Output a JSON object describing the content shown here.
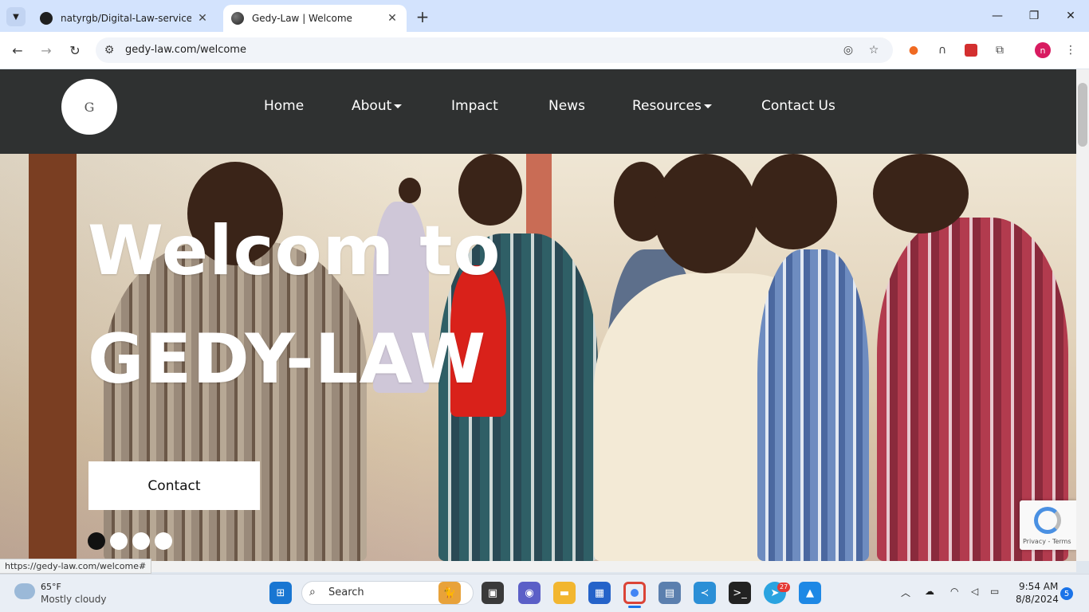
{
  "browser": {
    "tabs": [
      {
        "title": "natyrgb/Digital-Law-service: A p",
        "active": false
      },
      {
        "title": "Gedy-Law | Welcome",
        "active": true
      }
    ],
    "url": "gedy-law.com/welcome",
    "status_url": "https://gedy-law.com/welcome#"
  },
  "site": {
    "logo_letter": "G",
    "nav": {
      "home": "Home",
      "about": "About",
      "impact": "Impact",
      "news": "News",
      "resources": "Resources",
      "contact": "Contact Us"
    },
    "hero": {
      "line1": "Welcom to",
      "line2": "GEDY-LAW",
      "button": "Contact",
      "slides": 4,
      "active_slide": 1
    },
    "recaptcha": {
      "text": "Privacy - Terms"
    }
  },
  "taskbar": {
    "weather": {
      "temp": "65°F",
      "desc": "Mostly cloudy"
    },
    "search_placeholder": "Search",
    "telegram_badge": "27",
    "time": "9:54 AM",
    "date": "8/8/2024",
    "notifications": "5"
  },
  "colors": {
    "navbar": "#2f3131",
    "tabstrip": "#d3e3fd",
    "taskbar": "#e9eef5"
  }
}
